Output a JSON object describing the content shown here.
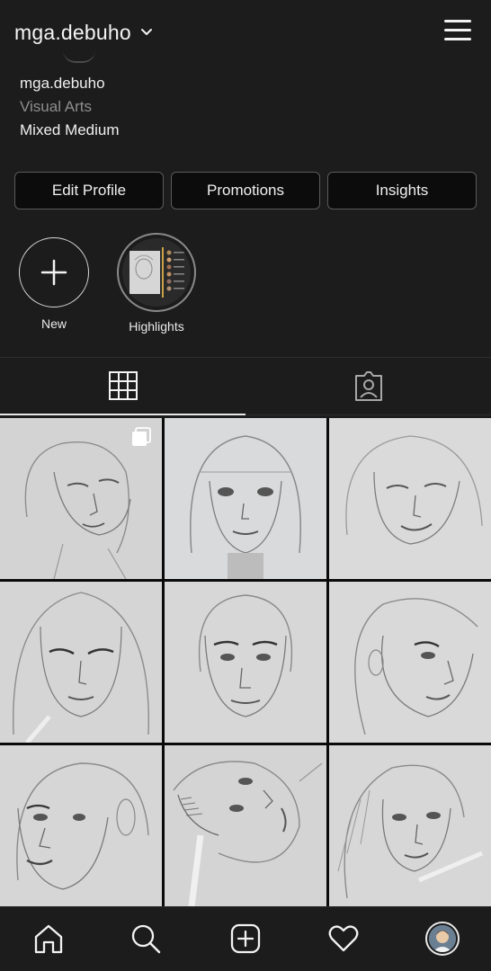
{
  "header": {
    "username": "mga.debuho",
    "icons": {
      "switch": "chevron-down-icon",
      "menu": "hamburger-menu-icon"
    }
  },
  "bio": {
    "name": "mga.debuho",
    "category": "Visual Arts",
    "text": "Mixed Medium"
  },
  "actions": [
    {
      "label": "Edit Profile"
    },
    {
      "label": "Promotions"
    },
    {
      "label": "Insights"
    }
  ],
  "stories": [
    {
      "label": "New",
      "icon": "plus-icon"
    },
    {
      "label": "Highlights",
      "icon": "highlight-cover"
    }
  ],
  "tabs": [
    {
      "name": "posts-grid",
      "icon": "grid-icon",
      "active": true
    },
    {
      "name": "tagged",
      "icon": "tagged-person-icon",
      "active": false
    }
  ],
  "posts": [
    {
      "description": "pencil-portrait",
      "multiple": true
    },
    {
      "description": "pencil-portrait",
      "multiple": false
    },
    {
      "description": "pencil-portrait",
      "multiple": false
    },
    {
      "description": "pencil-portrait",
      "multiple": false
    },
    {
      "description": "pencil-portrait",
      "multiple": false
    },
    {
      "description": "pencil-portrait",
      "multiple": false
    },
    {
      "description": "pencil-portrait",
      "multiple": false
    },
    {
      "description": "pencil-portrait",
      "multiple": false
    },
    {
      "description": "pencil-portrait",
      "multiple": false
    }
  ],
  "bottom_nav": [
    {
      "name": "home",
      "icon": "home-icon"
    },
    {
      "name": "search",
      "icon": "search-icon"
    },
    {
      "name": "create",
      "icon": "add-post-icon"
    },
    {
      "name": "activity",
      "icon": "heart-icon"
    },
    {
      "name": "profile",
      "icon": "profile-avatar"
    }
  ],
  "colors": {
    "background": "#1c1c1c",
    "text": "#f2f2f2",
    "muted": "#8e8e8e",
    "border": "#5b5b5b",
    "sketch_paper": "#dcdcdc"
  }
}
